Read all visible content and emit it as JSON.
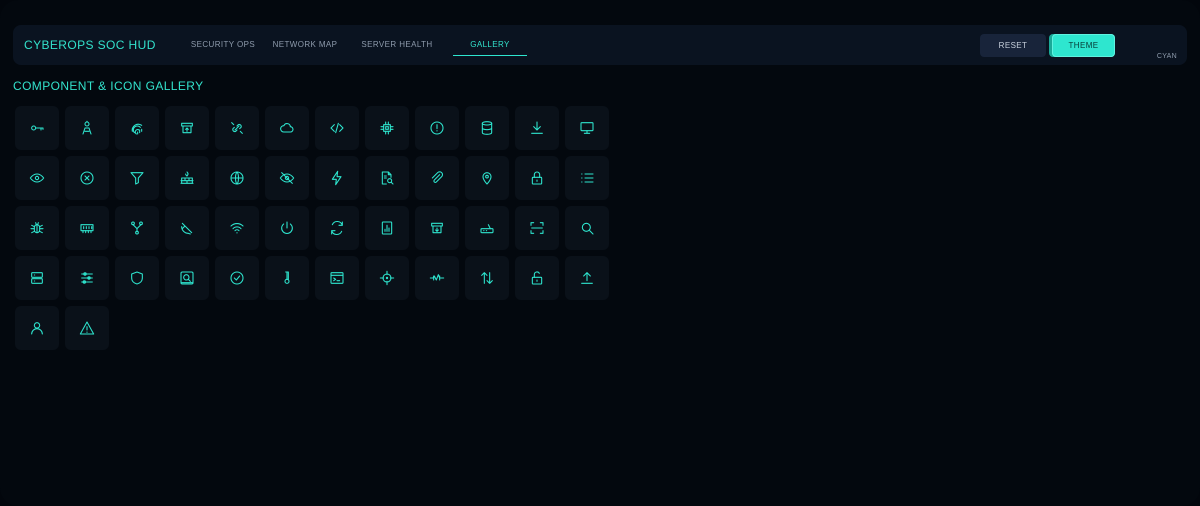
{
  "header": {
    "app_title": "CYBEROPS SOC HUD",
    "tabs": [
      "SECURITY OPS",
      "NETWORK MAP",
      "SERVER HEALTH",
      "GALLERY"
    ],
    "active_tab": "GALLERY",
    "reset_label": "RESET",
    "theme_label": "THEME",
    "theme_name": "CYAN"
  },
  "gallery": {
    "title": "COMPONENT & ICON GALLERY",
    "icons": [
      "key",
      "user-badge",
      "fingerprint",
      "archive-upload",
      "unlink",
      "cloud",
      "code",
      "cpu",
      "alert-octagon",
      "database",
      "download",
      "monitor",
      "eye",
      "x-circle",
      "filter",
      "firewall",
      "globe",
      "eye-off",
      "zap",
      "file-search",
      "paperclip",
      "map-pin",
      "lock",
      "list",
      "bug",
      "memory",
      "git-network",
      "satellite-dish",
      "wifi",
      "power",
      "refresh",
      "report",
      "archive-down",
      "router",
      "scan",
      "search",
      "server",
      "sliders",
      "shield",
      "safe-search",
      "check-circle",
      "thermometer",
      "terminal",
      "crosshair",
      "activity-pulse",
      "arrows-up-down",
      "unlock",
      "upload",
      "user",
      "warning"
    ]
  },
  "colors": {
    "accent": "#2ee6cf",
    "background": "#03080e",
    "panel": "#0a1320",
    "tile": "#0a1119"
  }
}
